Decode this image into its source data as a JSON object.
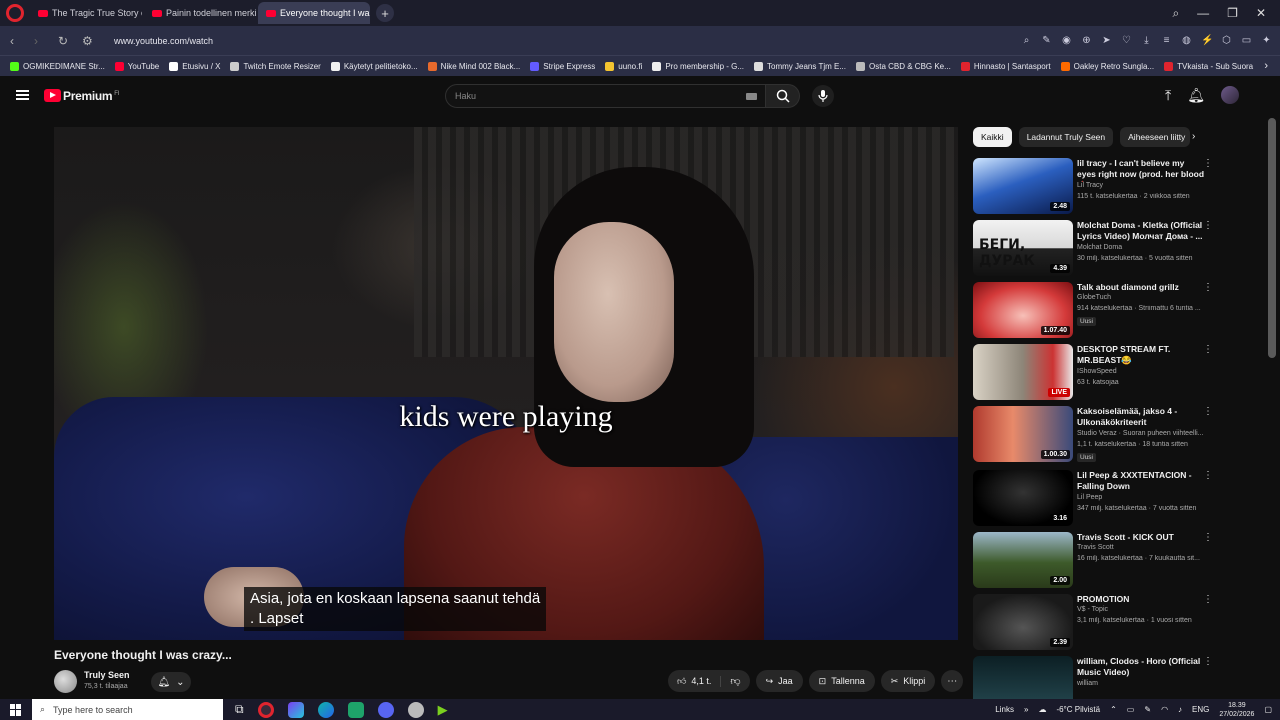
{
  "browser": {
    "tabs": [
      {
        "label": "The Tragic True Story of Ju",
        "active": false
      },
      {
        "label": "Painin todellinen merkity",
        "active": false
      },
      {
        "label": "Everyone thought I wa",
        "active": true
      }
    ],
    "url": "www.youtube.com/watch",
    "bookmarks": [
      {
        "label": "OGMIKEDIMANE Str...",
        "color": "#53fc18"
      },
      {
        "label": "YouTube",
        "color": "#ff0033"
      },
      {
        "label": "Etusivu / X",
        "color": "#ffffff"
      },
      {
        "label": "Twitch Emote Resizer",
        "color": "#cccccc"
      },
      {
        "label": "Käytetyt pelitietoko...",
        "color": "#f1f1f1"
      },
      {
        "label": "Nike Mind 002 Black...",
        "color": "#e86a2c"
      },
      {
        "label": "Stripe Express",
        "color": "#635bff"
      },
      {
        "label": "uuno.fi",
        "color": "#f4c430"
      },
      {
        "label": "Pro membership - G...",
        "color": "#eeeeee"
      },
      {
        "label": "Tommy Jeans Tjm E...",
        "color": "#dddddd"
      },
      {
        "label": "Osta CBD & CBG Ke...",
        "color": "#bbbbbb"
      },
      {
        "label": "Hinnasto | Santasport",
        "color": "#e0242e"
      },
      {
        "label": "Oakley Retro Sungla...",
        "color": "#ff6a00"
      },
      {
        "label": "TVkaista - Sub Suora",
        "color": "#e0242e"
      }
    ]
  },
  "header": {
    "logo": "Premium",
    "logo_sup": "FI",
    "search_placeholder": "Haku"
  },
  "video": {
    "burned_caption": "kids were playing",
    "cc_line1": "Asia, jota en koskaan lapsena saanut tehdä",
    "cc_line2": ". Lapset",
    "title": "Everyone thought I was crazy...",
    "channel": "Truly Seen",
    "subscribers": "75,3 t. tilaajaa",
    "likes": "4,1 t.",
    "share": "Jaa",
    "save": "Tallenna",
    "clip": "Klippi"
  },
  "chips": [
    "Kaikki",
    "Ladannut Truly Seen",
    "Aiheeseen liitty"
  ],
  "recommendations": [
    {
      "title": "lil tracy - I can't believe my eyes right now (prod. her blood 🩸)",
      "channel": "Lil Tracy",
      "meta": "115 t. katselukertaa · 2 viikkoa sitten",
      "duration": "2.48",
      "badge": ""
    },
    {
      "title": "Molchat Doma - Kletka (Official Lyrics Video) Молчат Дома - ...",
      "channel": "Molchat Doma",
      "meta": "30 milj. katselukertaa · 5 vuotta sitten",
      "duration": "4.39",
      "badge": ""
    },
    {
      "title": "Talk about diamond grillz",
      "channel": "GlobeTuch",
      "meta": "914 katselukertaa · Striimattu 6 tuntia ...",
      "duration": "1.07.40",
      "badge": "Uusi"
    },
    {
      "title": "DESKTOP STREAM FT. MR.BEAST😂",
      "channel": "IShowSpeed",
      "meta": "63 t. katsojaa",
      "duration": "LIVE",
      "badge": ""
    },
    {
      "title": "Kaksoiselämää, jakso 4 - Ulkonäkökriteerit",
      "channel": "Studio Veraz · Suoran puheen viihteelli...",
      "meta": "1,1 t. katselukertaa · 18 tuntia sitten",
      "duration": "1.00.30",
      "badge": "Uusi"
    },
    {
      "title": "Lil Peep & XXXTENTACION - Falling Down",
      "channel": "Lil Peep",
      "meta": "347 milj. katselukertaa · 7 vuotta sitten",
      "duration": "3.16",
      "badge": ""
    },
    {
      "title": "Travis Scott - KICK OUT",
      "channel": "Travis Scott",
      "meta": "16 milj. katselukertaa · 7 kuukautta sit...",
      "duration": "2.00",
      "badge": ""
    },
    {
      "title": "PROMOTION",
      "channel": "V$ - Topic",
      "meta": "3,1 milj. katselukertaa · 1 vuosi sitten",
      "duration": "2.39",
      "badge": ""
    },
    {
      "title": "william, Clodos - Horo (Official Music Video)",
      "channel": "william",
      "meta": "",
      "duration": "",
      "badge": ""
    }
  ],
  "taskbar": {
    "search_placeholder": "Type here to search",
    "links": "Links",
    "weather": "-6°C  Pilvistä",
    "lang": "ENG",
    "time": "18.39",
    "date": "27/02/2026"
  }
}
